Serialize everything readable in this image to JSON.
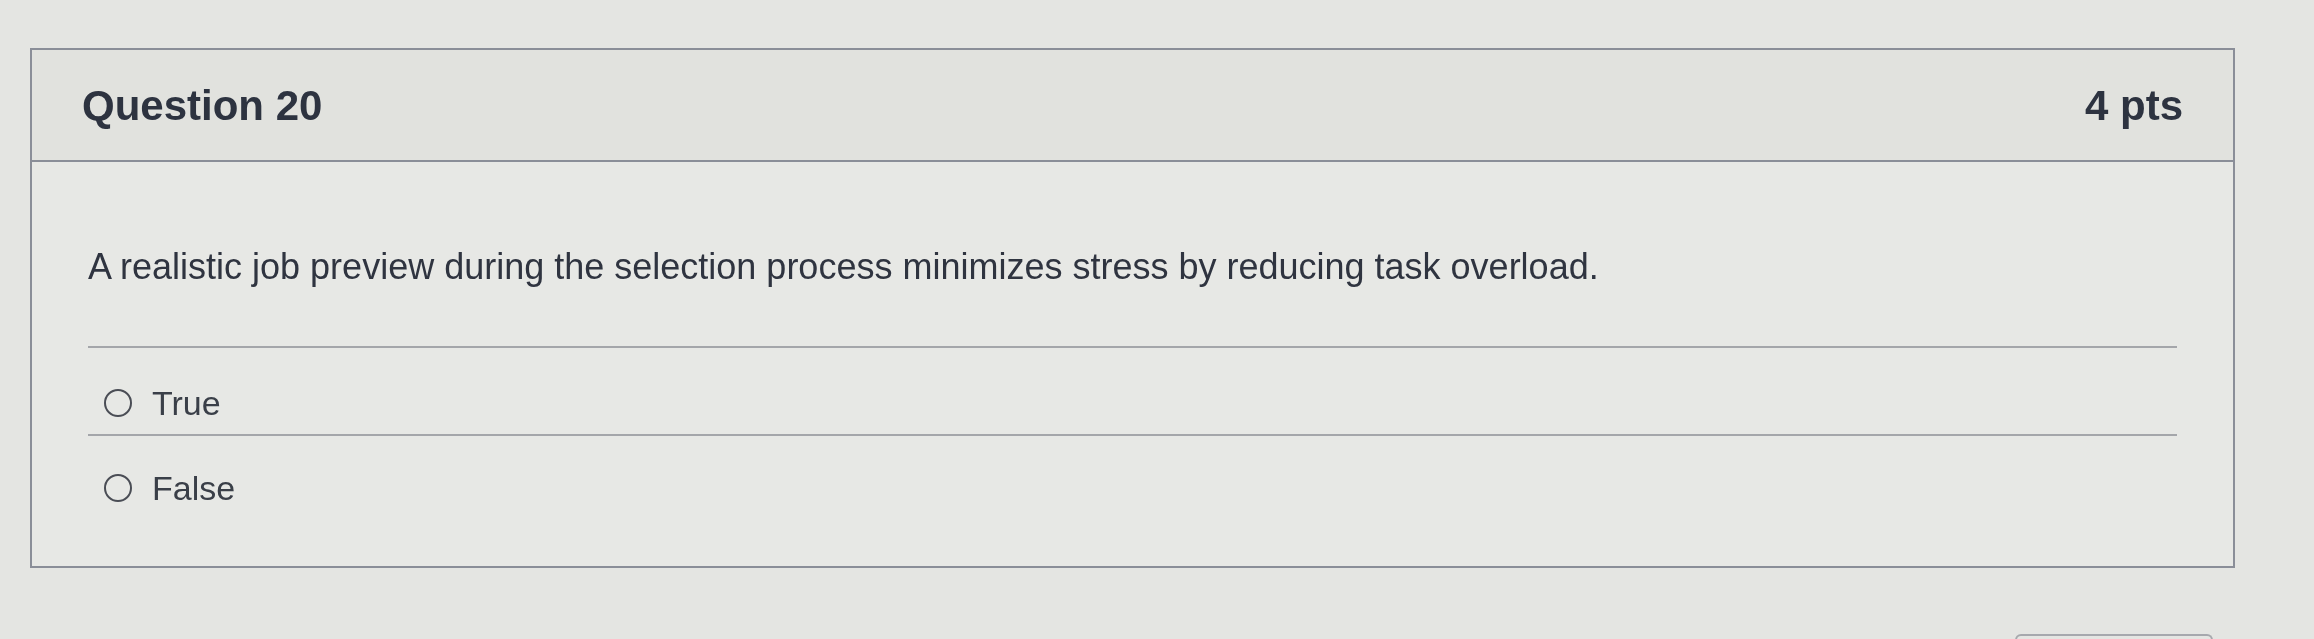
{
  "question": {
    "title": "Question 20",
    "points": "4 pts",
    "text": "A realistic job preview during the selection process minimizes stress by reducing task overload."
  },
  "options": [
    {
      "label": "True",
      "selected": false
    },
    {
      "label": "False",
      "selected": false
    }
  ]
}
